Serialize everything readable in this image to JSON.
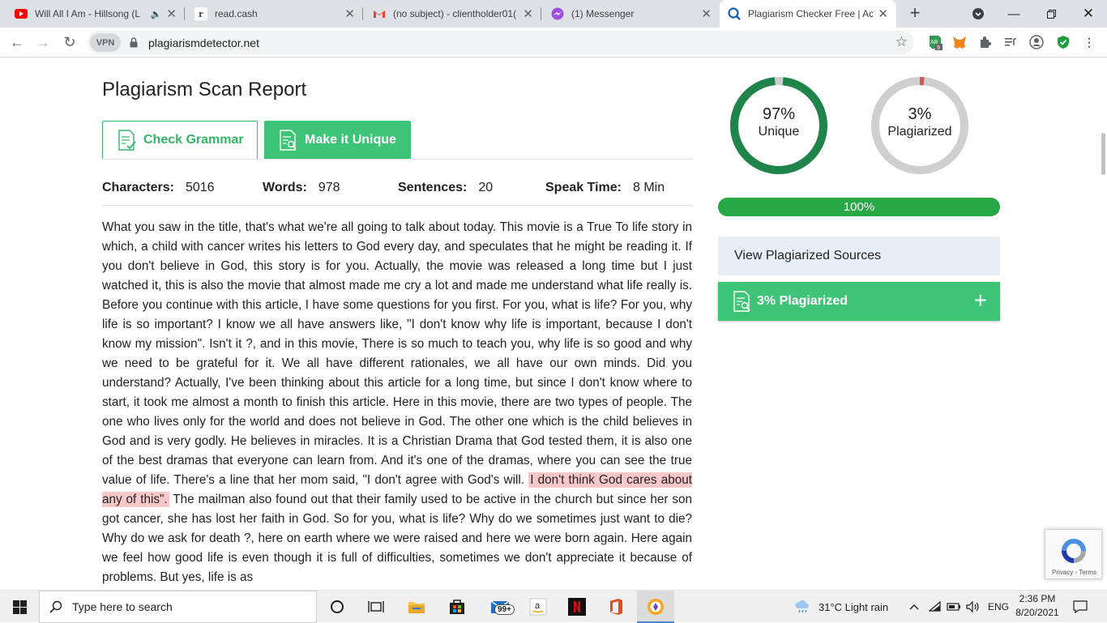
{
  "browser": {
    "tabs": [
      {
        "title": "Will All I Am - Hillsong (L",
        "icon": "youtube-icon"
      },
      {
        "title": "read.cash",
        "icon": "readcash-icon"
      },
      {
        "title": "(no subject) - clientholder01(",
        "icon": "gmail-icon"
      },
      {
        "title": "(1) Messenger",
        "icon": "messenger-icon"
      },
      {
        "title": "Plagiarism Checker Free | Acc",
        "icon": "plagiarism-icon",
        "active": true
      }
    ],
    "vpn_label": "VPN",
    "url": "plagiarismdetector.net",
    "ext_badge": "9"
  },
  "report": {
    "title": "Plagiarism Scan Report",
    "check_grammar_label": "Check Grammar",
    "make_unique_label": "Make it Unique",
    "stats": [
      {
        "label": "Characters:",
        "value": "5016"
      },
      {
        "label": "Words:",
        "value": "978"
      },
      {
        "label": "Sentences:",
        "value": "20"
      },
      {
        "label": "Speak Time:",
        "value": "8 Min"
      }
    ],
    "text_before": "What you saw in the title, that's what we're all going to talk about today. This movie is a True To life story in which, a child with cancer writes his letters to God every day, and speculates that he might be reading it. If you don't believe in God, this story is for you. Actually, the movie was released a long time but I just watched it, this is also the movie that almost made me cry a lot and made me understand what life really is. Before you continue with this article, I have some questions for you first.  For you, what is life?  For you, why life is so important?  I know we all have answers like, \"I don't know why life is important, because I don't know my mission\". Isn't it ?, and in this movie, There is so much to teach you, why life is so good and why we need to be grateful for it. We all have different rationales, we all have our own minds. Did you understand? Actually, I've been thinking about this article for a long time, but since I don't know where to start, it took me almost a month to finish this article.  Here in this movie, there are two types of people. The one who lives only for the world and does not believe in God. The other one which is the child believes in God and is very godly. He believes in miracles. It is a Christian Drama that God tested them, it is also one of the best dramas that everyone can learn from. And it's one of the dramas, where you can see the true value of life. There's a line that her mom said, \"I don't agree with God's will. ",
    "text_highlight": "I don't think God cares about any of this\".",
    "text_after": " The mailman also found out that their family used to be active in the church but since her son got cancer, she has lost her faith in God. So for you, what is life? Why do we sometimes just want to die? Why do we ask for death ?, here on earth where we were raised and here we were born again. Here again we feel how good life is even though it is full of difficulties, sometimes we don't appreciate it because of problems. But yes, life is as"
  },
  "results": {
    "unique_percent": "97%",
    "unique_label": "Unique",
    "unique_fraction": 0.97,
    "plagiarized_percent": "3%",
    "plagiarized_label": "Plagiarized",
    "plagiarized_fraction": 0.03,
    "progress_label": "100%",
    "progress_fraction": 1.0,
    "view_sources_label": "View Plagiarized Sources",
    "plagiarized_bar_label": "3% Plagiarized",
    "colors": {
      "unique": "#1e8449",
      "plagiarized": "#e05252",
      "track": "#cfcfcf",
      "accent": "#3ec476"
    }
  },
  "recaptcha": {
    "links": "Privacy - Terms"
  },
  "taskbar": {
    "search_placeholder": "Type here to search",
    "mail_badge": "99+",
    "weather": "31°C  Light rain",
    "language": "ENG",
    "time": "2:36 PM",
    "date": "8/20/2021"
  }
}
